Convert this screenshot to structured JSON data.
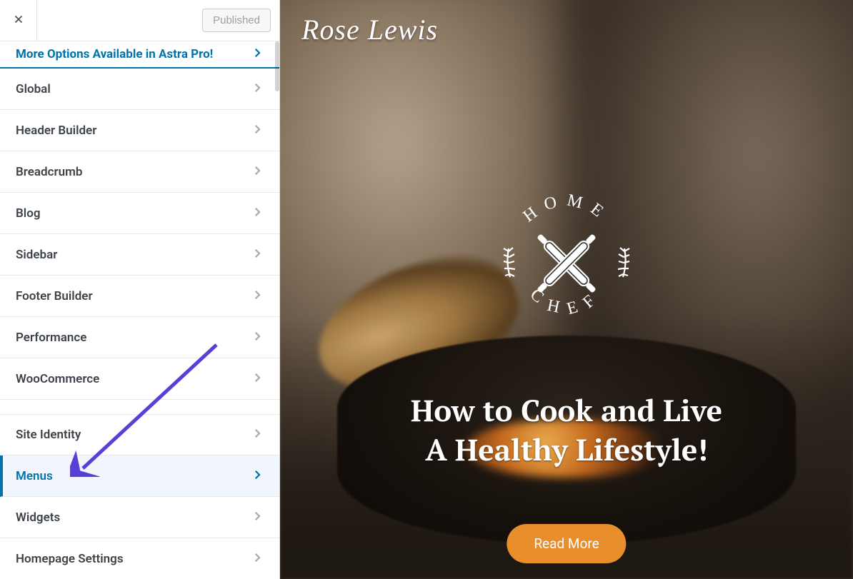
{
  "topbar": {
    "published_label": "Published"
  },
  "promo": {
    "label": "More Options Available in Astra Pro!"
  },
  "items": [
    {
      "label": "Global",
      "active": false,
      "gap": false
    },
    {
      "label": "Header Builder",
      "active": false,
      "gap": false
    },
    {
      "label": "Breadcrumb",
      "active": false,
      "gap": false
    },
    {
      "label": "Blog",
      "active": false,
      "gap": false
    },
    {
      "label": "Sidebar",
      "active": false,
      "gap": false
    },
    {
      "label": "Footer Builder",
      "active": false,
      "gap": false
    },
    {
      "label": "Performance",
      "active": false,
      "gap": false
    },
    {
      "label": "WooCommerce",
      "active": false,
      "gap": false
    },
    {
      "label": "Site Identity",
      "active": false,
      "gap": true
    },
    {
      "label": "Menus",
      "active": true,
      "gap": false
    },
    {
      "label": "Widgets",
      "active": false,
      "gap": false
    },
    {
      "label": "Homepage Settings",
      "active": false,
      "gap": false
    }
  ],
  "preview": {
    "brand": "Rose Lewis",
    "badge": {
      "top_word": "HOME",
      "bottom_word": "CHEF"
    },
    "hero": {
      "line1": "How to Cook and Live",
      "line2": "A Healthy Lifestyle!"
    },
    "cta_label": "Read More"
  },
  "annotation": {
    "arrow_color": "#5a3fd6"
  }
}
